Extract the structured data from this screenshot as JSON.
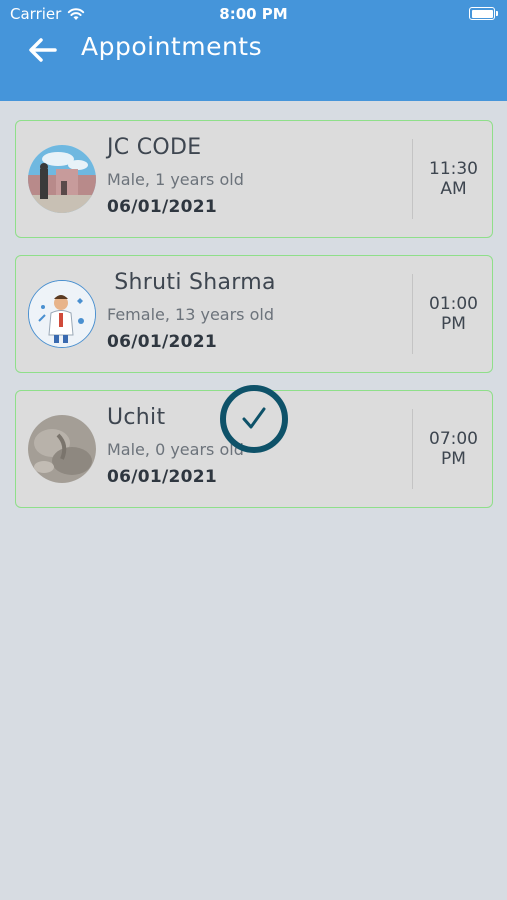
{
  "status_bar": {
    "carrier": "Carrier",
    "time": "8:00 PM"
  },
  "header": {
    "title": "Appointments"
  },
  "appointments": [
    {
      "name": "JC CODE",
      "detail": "Male, 1 years old",
      "date": "06/01/2021",
      "time": "11:30\nAM"
    },
    {
      "name": " Shruti Sharma",
      "detail": "Female, 13 years old",
      "date": "06/01/2021",
      "time": "01:00\nPM"
    },
    {
      "name": "Uchit",
      "detail": "Male, 0 years old",
      "date": "06/01/2021",
      "time": "07:00\nPM"
    }
  ],
  "colors": {
    "header": "#4595da",
    "background": "#d7dce2",
    "card_border": "#8fdf8a",
    "check_ring": "#0e5269"
  }
}
